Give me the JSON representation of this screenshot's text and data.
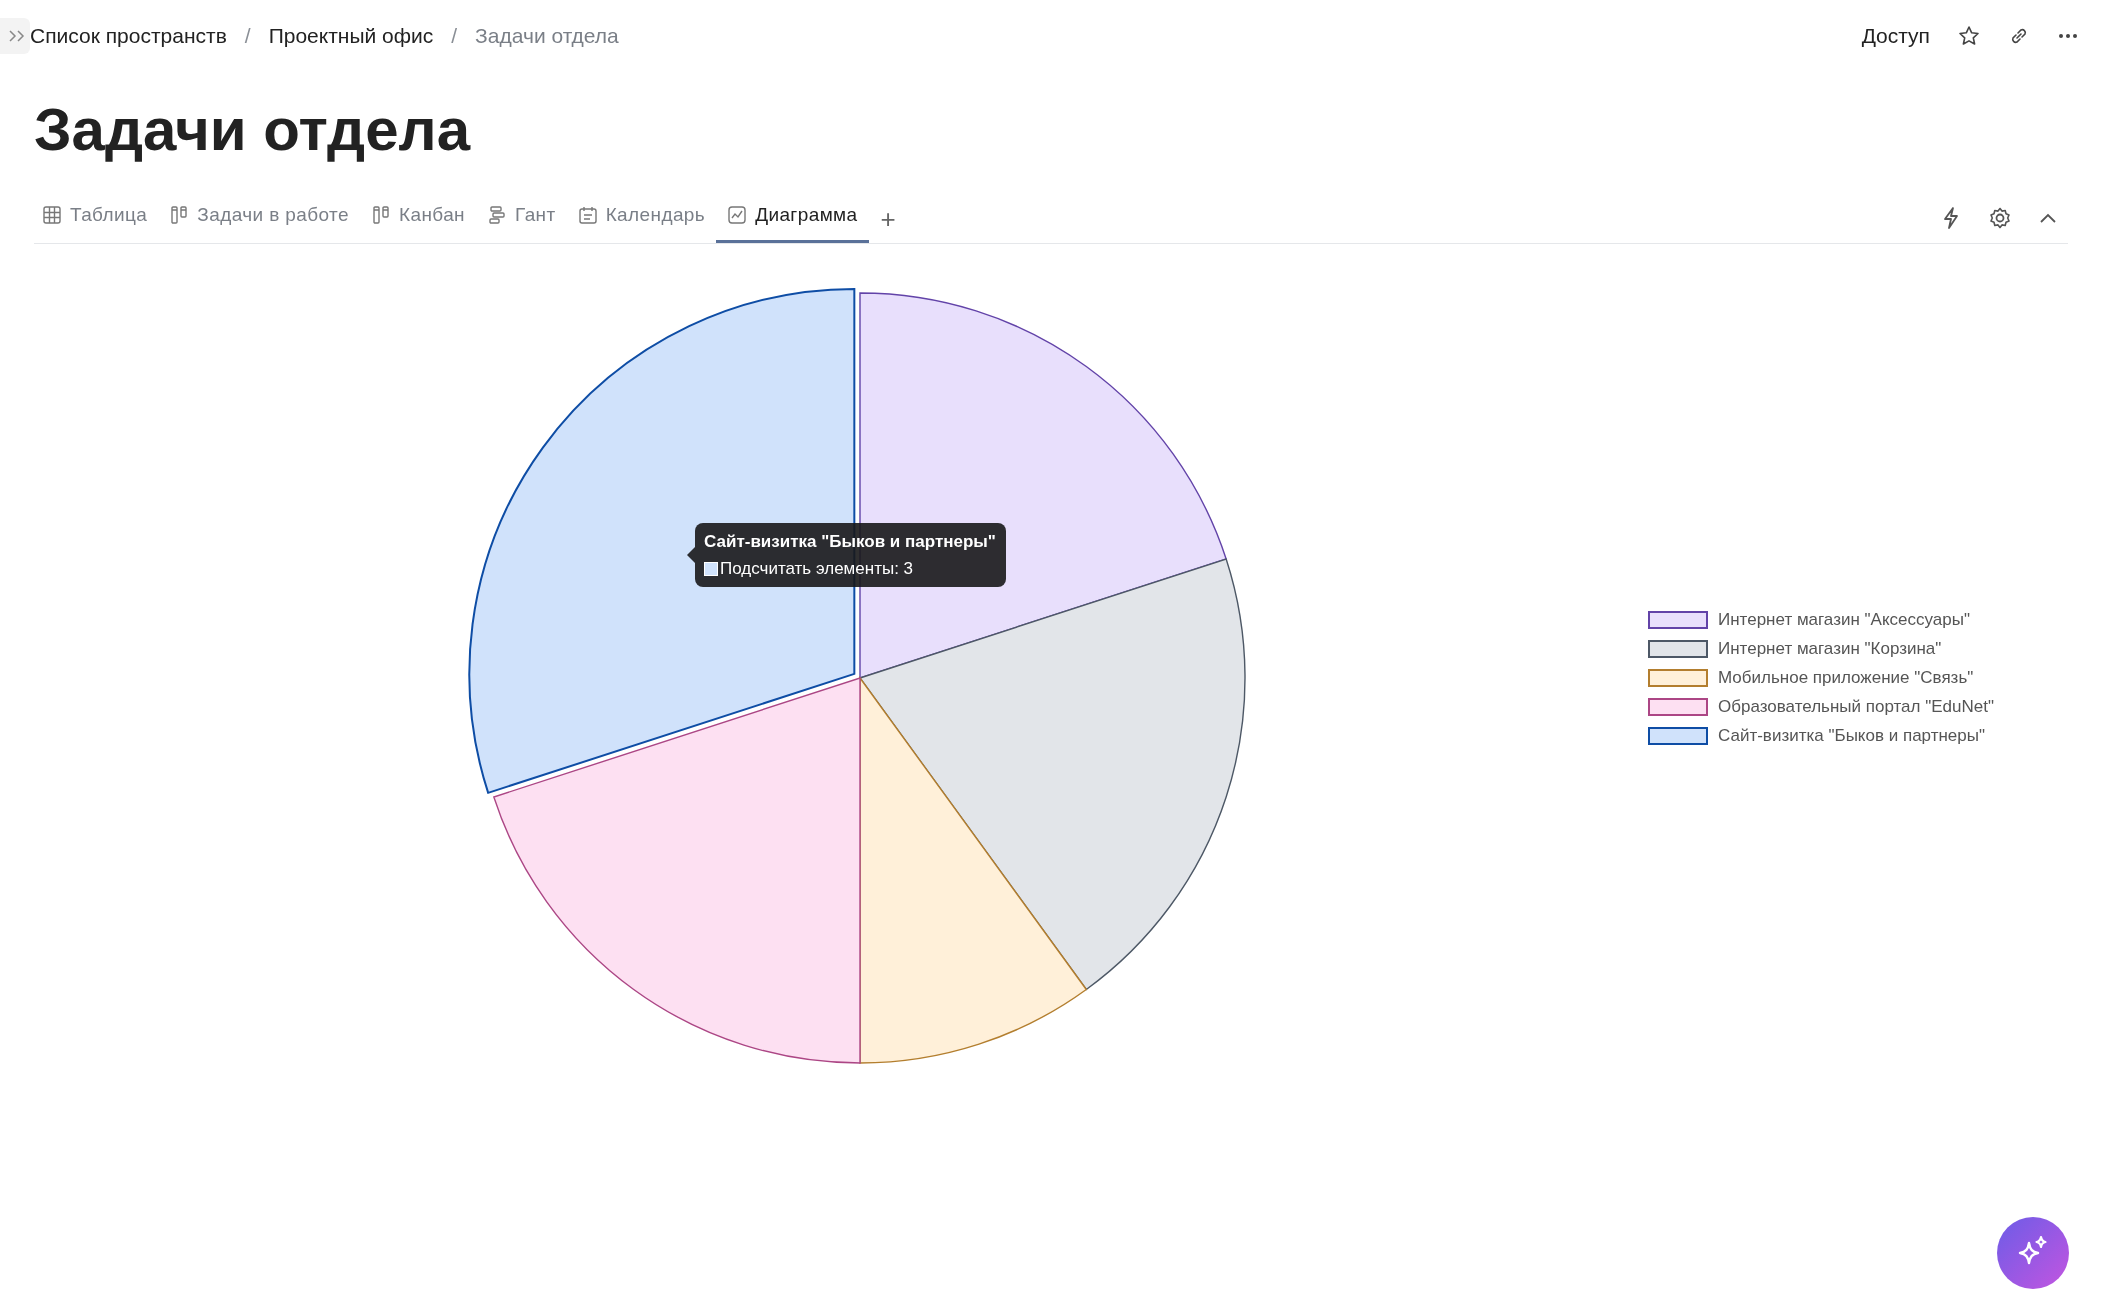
{
  "breadcrumbs": [
    {
      "label": "Список пространств",
      "current": false
    },
    {
      "label": "Проектный офис",
      "current": false
    },
    {
      "label": "Задачи отдела",
      "current": true
    }
  ],
  "breadcrumb_separator": "/",
  "header_actions": {
    "access": "Доступ"
  },
  "title": "Задачи отдела",
  "tabs": [
    {
      "label": "Таблица",
      "kind": "table",
      "selected": false
    },
    {
      "label": "Задачи в работе",
      "kind": "board",
      "selected": false
    },
    {
      "label": "Канбан",
      "kind": "board",
      "selected": false
    },
    {
      "label": "Гант",
      "kind": "gantt",
      "selected": false
    },
    {
      "label": "Календарь",
      "kind": "calendar",
      "selected": false
    },
    {
      "label": "Диаграмма",
      "kind": "chart",
      "selected": true
    }
  ],
  "add_tab": "+",
  "chart": {
    "chart_data": {
      "type": "pie",
      "categories": [
        "Интернет магазин \"Аксессуары\"",
        "Интернет магазин \"Корзина\"",
        "Мобильное приложение \"Связь\"",
        "Образовательный портал \"EduNet\"",
        "Сайт-визитка \"Быков и партнеры\""
      ],
      "values": [
        20,
        20,
        10,
        20,
        30
      ],
      "colors": [
        "#e8dffc",
        "#e2e5e9",
        "#fff0d9",
        "#fde0f2",
        "#d0e2fb"
      ],
      "legend": true
    },
    "slices": [
      {
        "highlighted": false
      },
      {
        "highlighted": false
      },
      {
        "highlighted": false
      },
      {
        "highlighted": false
      },
      {
        "highlighted": true
      }
    ],
    "tooltip": {
      "title": "Сайт-визитка \"Быков и партнеры\"",
      "text": "Подсчитать элементы: 3",
      "color": "#d0e2fb"
    }
  }
}
